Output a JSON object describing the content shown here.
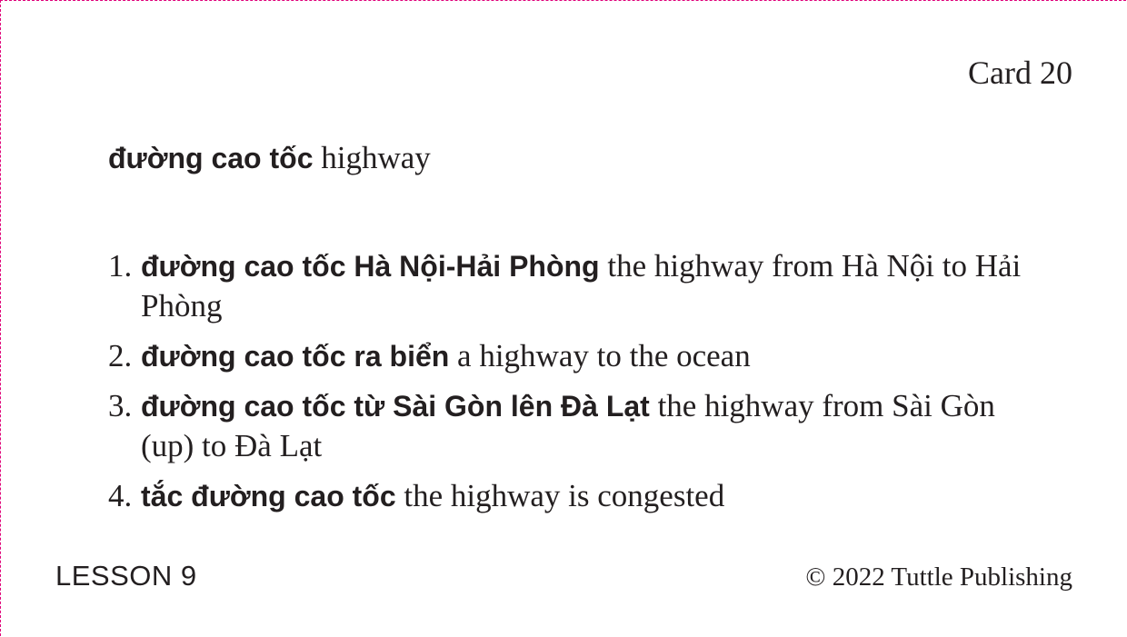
{
  "card": {
    "number_label": "Card 20",
    "border_color": "#e0007a"
  },
  "headword": {
    "vietnamese": "đường cao tốc",
    "english": "highway"
  },
  "examples": [
    {
      "number": "1.",
      "vietnamese": "đường cao tốc Hà Nội-Hải Phòng",
      "english": "the highway from Hà Nội to Hải Phòng"
    },
    {
      "number": "2.",
      "vietnamese": "đường cao tốc ra biển",
      "english": "a highway to the ocean"
    },
    {
      "number": "3.",
      "vietnamese": "đường cao tốc từ Sài Gòn lên Đà Lạt",
      "english": "the highway from Sài Gòn (up) to Đà Lạt"
    },
    {
      "number": "4.",
      "vietnamese": "tắc đường cao tốc",
      "english": "the highway is congested"
    }
  ],
  "footer": {
    "lesson": "LESSON 9",
    "copyright": "© 2022 Tuttle Publishing"
  }
}
